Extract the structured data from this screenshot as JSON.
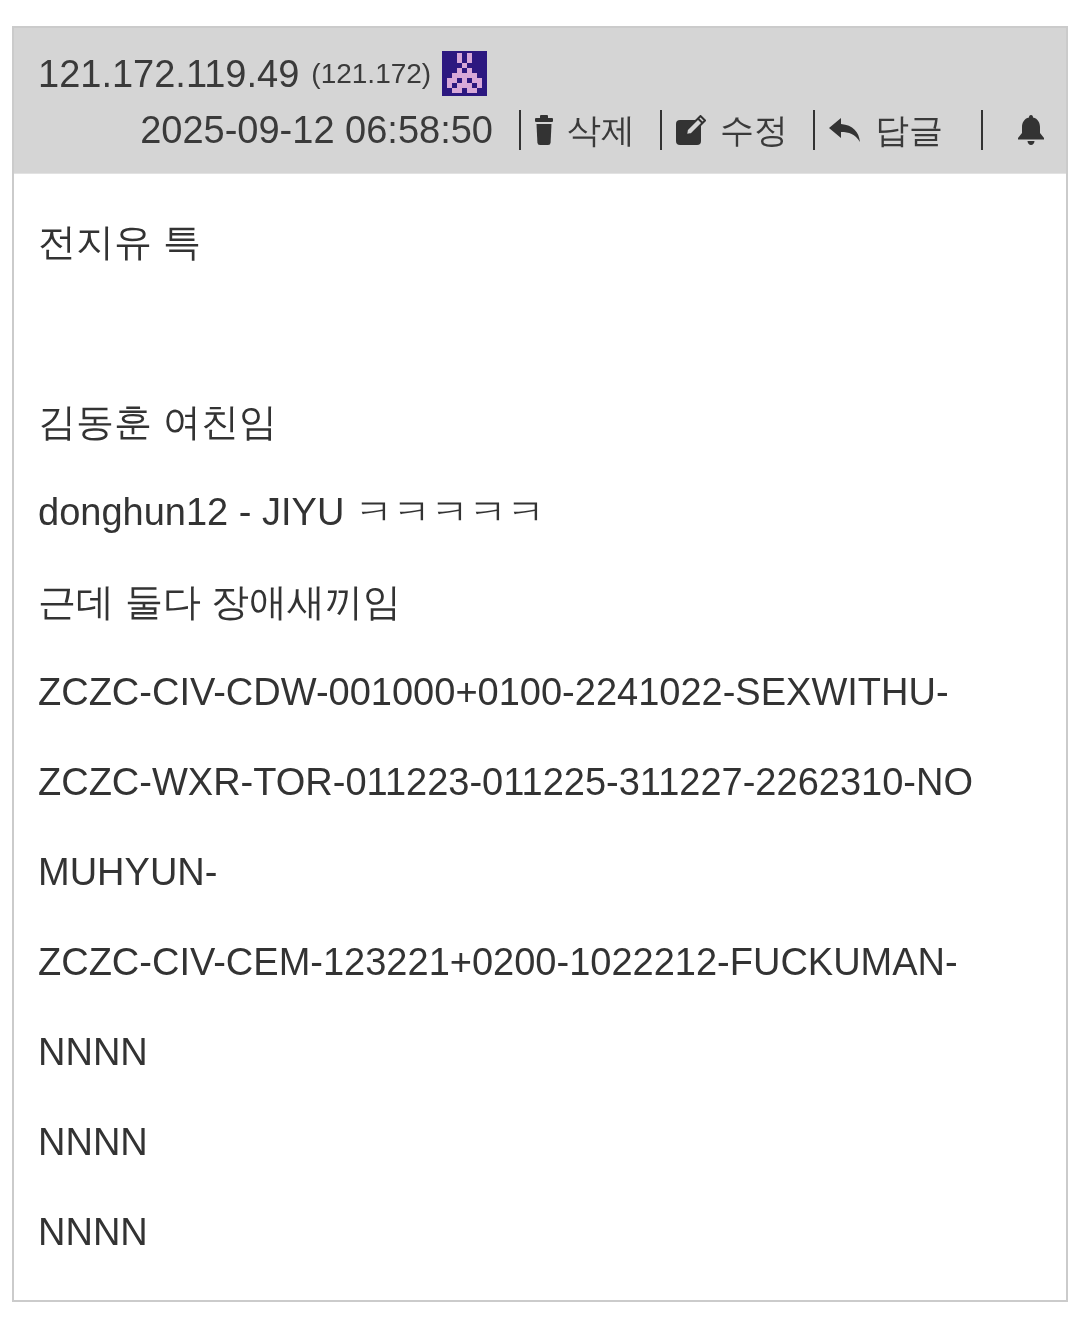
{
  "post": {
    "header": {
      "ip": "121.172.119.49",
      "ip_prefix": "(121.172)",
      "date": "2025-09-12 06:58:50",
      "actions": [
        {
          "kind": "delete",
          "label": "삭제"
        },
        {
          "kind": "edit",
          "label": "수정"
        },
        {
          "kind": "reply",
          "label": "답글"
        },
        {
          "kind": "notify"
        }
      ]
    },
    "body": {
      "blocks": [
        {
          "lines": [
            "전지유 특"
          ]
        },
        {
          "lines": [
            "김동훈 여친임",
            "donghun12 - JIYU ㅋㅋㅋㅋㅋ",
            "근데 둘다 장애새끼임",
            "ZCZC-CIV-CDW-001000+0100-2241022-SEXWITHU-",
            "ZCZC-WXR-TOR-011223-011225-311227-2262310-NO",
            "MUHYUN-",
            "ZCZC-CIV-CEM-123221+0200-1022212-FUCKUMAN-",
            "NNNN",
            "NNNN",
            "NNNN"
          ]
        }
      ]
    }
  }
}
